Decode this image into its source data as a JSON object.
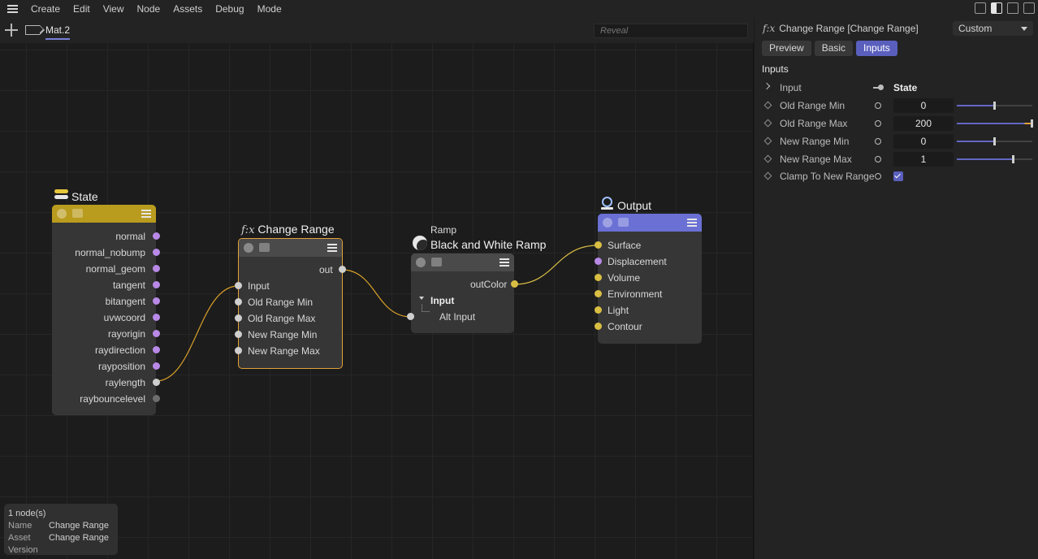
{
  "menu": {
    "items": [
      "Create",
      "Edit",
      "View",
      "Node",
      "Assets",
      "Debug",
      "Mode"
    ]
  },
  "tabbar": {
    "active_tab": "Mat.2",
    "reveal_placeholder": "Reveal"
  },
  "nodes": {
    "state": {
      "title": "State",
      "header_color": "#b99b1e",
      "ports": [
        "normal",
        "normal_nobump",
        "normal_geom",
        "tangent",
        "bitangent",
        "uvwcoord",
        "rayorigin",
        "raydirection",
        "rayposition",
        "raylength",
        "raybouncelevel"
      ]
    },
    "change_range": {
      "title_prefix": "f:x",
      "title": "Change Range",
      "header_color": "#4a4a4a",
      "output": "out",
      "inputs": [
        "Input",
        "Old Range Min",
        "Old Range Max",
        "New Range Min",
        "New Range Max"
      ]
    },
    "ramp": {
      "subtitle": "Ramp",
      "title": "Black and White Ramp",
      "header_color": "#4a4a4a",
      "output": "outColor",
      "group": "Input",
      "input": "Alt Input"
    },
    "output": {
      "title": "Output",
      "header_color": "#6a70d4",
      "inputs": [
        "Surface",
        "Displacement",
        "Volume",
        "Environment",
        "Light",
        "Contour"
      ]
    }
  },
  "info": {
    "count": "1 node(s)",
    "name_label": "Name",
    "name_value": "Change Range",
    "asset_label": "Asset",
    "asset_value": "Change Range",
    "version_label": "Version"
  },
  "panel": {
    "title_prefix": "f:x",
    "title": "Change Range [Change Range]",
    "preset": "Custom",
    "tabs": [
      "Preview",
      "Basic",
      "Inputs"
    ],
    "active_tab": "Inputs",
    "section": "Inputs",
    "input": {
      "label": "Input",
      "value": "State"
    },
    "params": [
      {
        "label": "Old Range Min",
        "value": "0",
        "slider": 0.5
      },
      {
        "label": "Old Range Max",
        "value": "200",
        "slider": 1.0
      },
      {
        "label": "New Range Min",
        "value": "0",
        "slider": 0.5
      },
      {
        "label": "New Range Max",
        "value": "1",
        "slider": 0.75
      }
    ],
    "clamp": {
      "label": "Clamp To New Range",
      "checked": true
    },
    "accent": "#5a5fbd"
  }
}
